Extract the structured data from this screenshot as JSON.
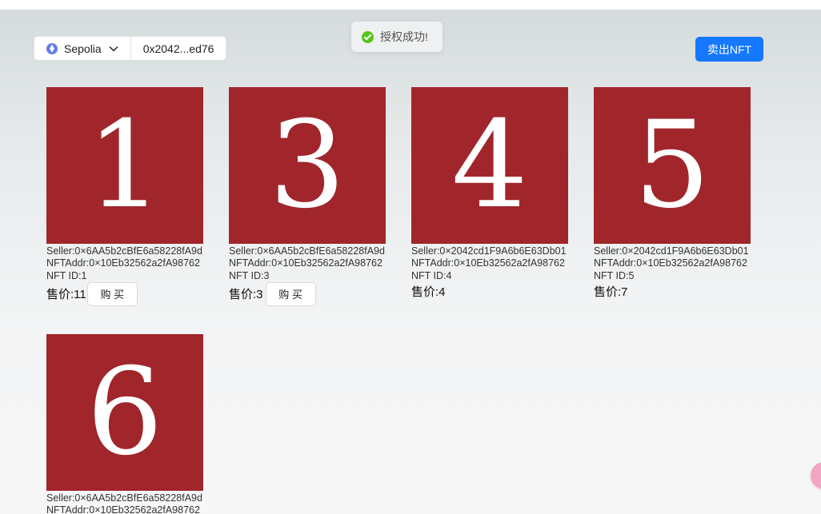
{
  "header": {
    "network": "Sepolia",
    "account": "0x2042...ed76",
    "sell_button": "卖出NFT"
  },
  "toast": {
    "message": "授权成功!"
  },
  "nfts": [
    {
      "image_text": "1",
      "seller": "Seller:0×6AA5b2cBfE6a58228fA9d",
      "nft_addr": "NFTAddr:0×10Eb32562a2fA98762",
      "nft_id": "NFT ID:1",
      "price": "售价:11",
      "buy_label": "购 买"
    },
    {
      "image_text": "3",
      "seller": "Seller:0×6AA5b2cBfE6a58228fA9d",
      "nft_addr": "NFTAddr:0×10Eb32562a2fA98762",
      "nft_id": "NFT ID:3",
      "price": "售价:3",
      "buy_label": "购 买"
    },
    {
      "image_text": "4",
      "seller": "Seller:0×2042cd1F9A6b6E63Db01",
      "nft_addr": "NFTAddr:0×10Eb32562a2fA98762",
      "nft_id": "NFT ID:4",
      "price": "售价:4"
    },
    {
      "image_text": "5",
      "seller": "Seller:0×2042cd1F9A6b6E63Db01",
      "nft_addr": "NFTAddr:0×10Eb32562a2fA98762",
      "nft_id": "NFT ID:5",
      "price": "售价:7"
    },
    {
      "image_text": "6",
      "seller": "Seller:0×6AA5b2cBfE6a58228fA9d",
      "nft_addr": "NFTAddr:0×10Eb32562a2fA98762"
    }
  ],
  "colors": {
    "accent": "#1677ff",
    "nft_background": "#a0262b",
    "success": "#52c41a",
    "network_icon": "#627eea"
  },
  "icons": {
    "network": "ethereum-icon",
    "dropdown": "chevron-down-icon",
    "toast": "check-circle-icon"
  }
}
